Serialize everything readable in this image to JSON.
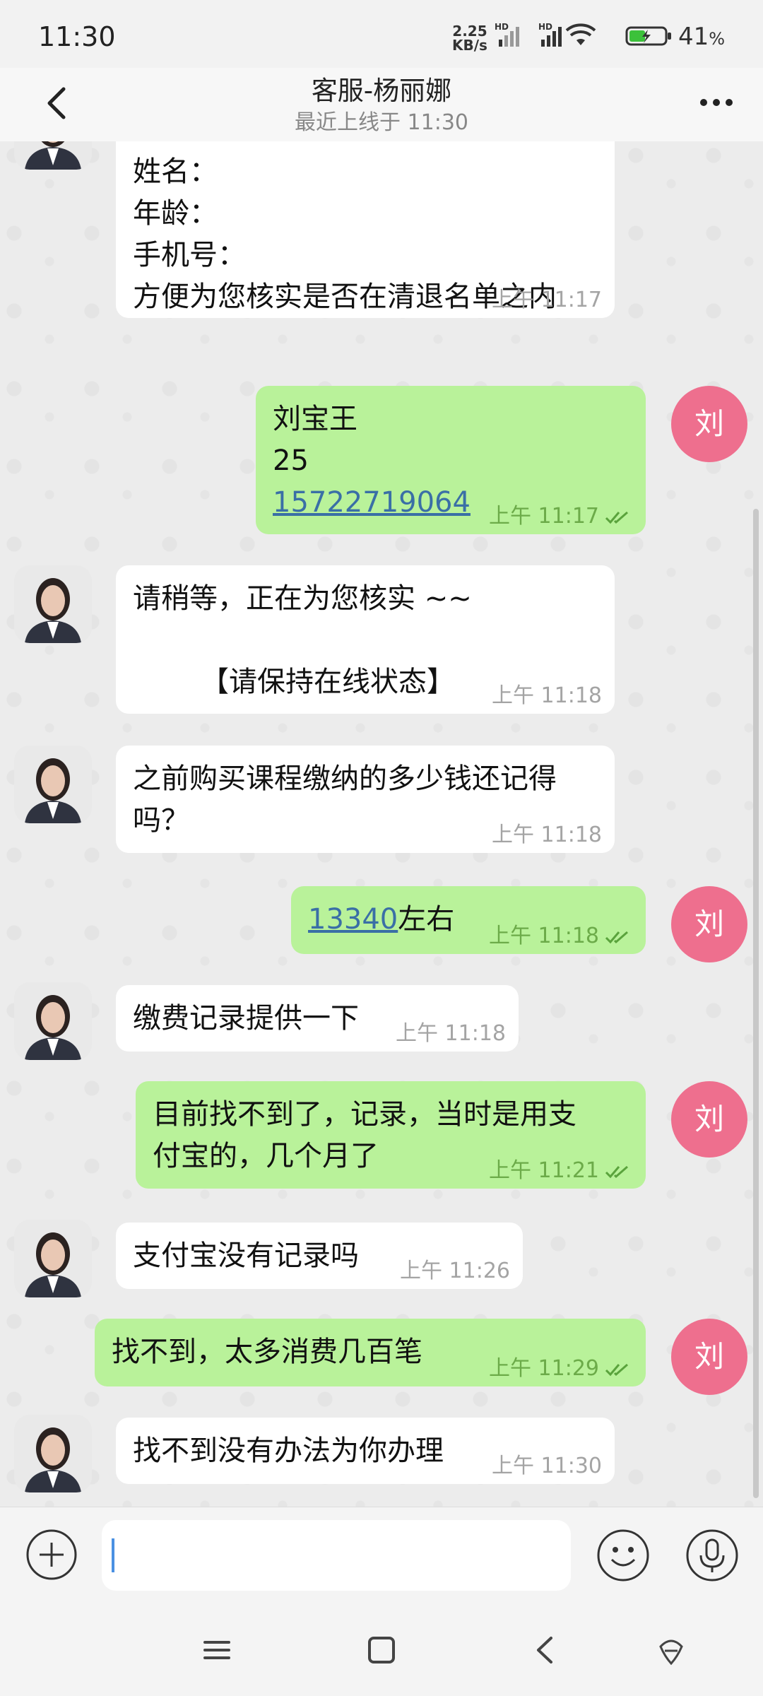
{
  "status_bar": {
    "time": "11:30",
    "net_speed_top": "2.25",
    "net_speed_bottom": "KB/s",
    "battery": "41",
    "battery_unit": "%"
  },
  "header": {
    "title": "客服-杨丽娜",
    "subtitle": "最近上线于 11:30"
  },
  "me_initial": "刘",
  "messages": {
    "m1": {
      "lines": [
        "姓名：",
        "年龄：",
        "手机号：",
        "方便为您核实是否在清退名单之内"
      ],
      "time": "上午 11:17"
    },
    "m2": {
      "name": "刘宝王",
      "age": "25",
      "phone": "15722719064",
      "time": "上午 11:17"
    },
    "m3": {
      "line1": "请稍等，正在为您核实 ~~",
      "line2": "【请保持在线状态】",
      "time": "上午 11:18"
    },
    "m4": {
      "line1": "之前购买课程缴纳的多少钱还记得",
      "line2": "吗？",
      "time": "上午 11:18"
    },
    "m5": {
      "amount": "13340",
      "suffix": "左右",
      "time": "上午 11:18"
    },
    "m6": {
      "text": "缴费记录提供一下",
      "time": "上午 11:18"
    },
    "m7": {
      "line1": "目前找不到了，记录，当时是用支",
      "line2": "付宝的，几个月了",
      "time": "上午 11:21"
    },
    "m8": {
      "text": "支付宝没有记录吗",
      "time": "上午 11:26"
    },
    "m9": {
      "text": "找不到，太多消费几百笔",
      "time": "上午 11:29"
    },
    "m10": {
      "text": "找不到没有办法为你办理",
      "time": "上午 11:30"
    }
  },
  "input": {
    "value": ""
  },
  "colors": {
    "outgoing": "#b9f29a",
    "incoming": "#ffffff",
    "avatar_me": "#ee6f8e",
    "link": "#3a6fa6"
  }
}
